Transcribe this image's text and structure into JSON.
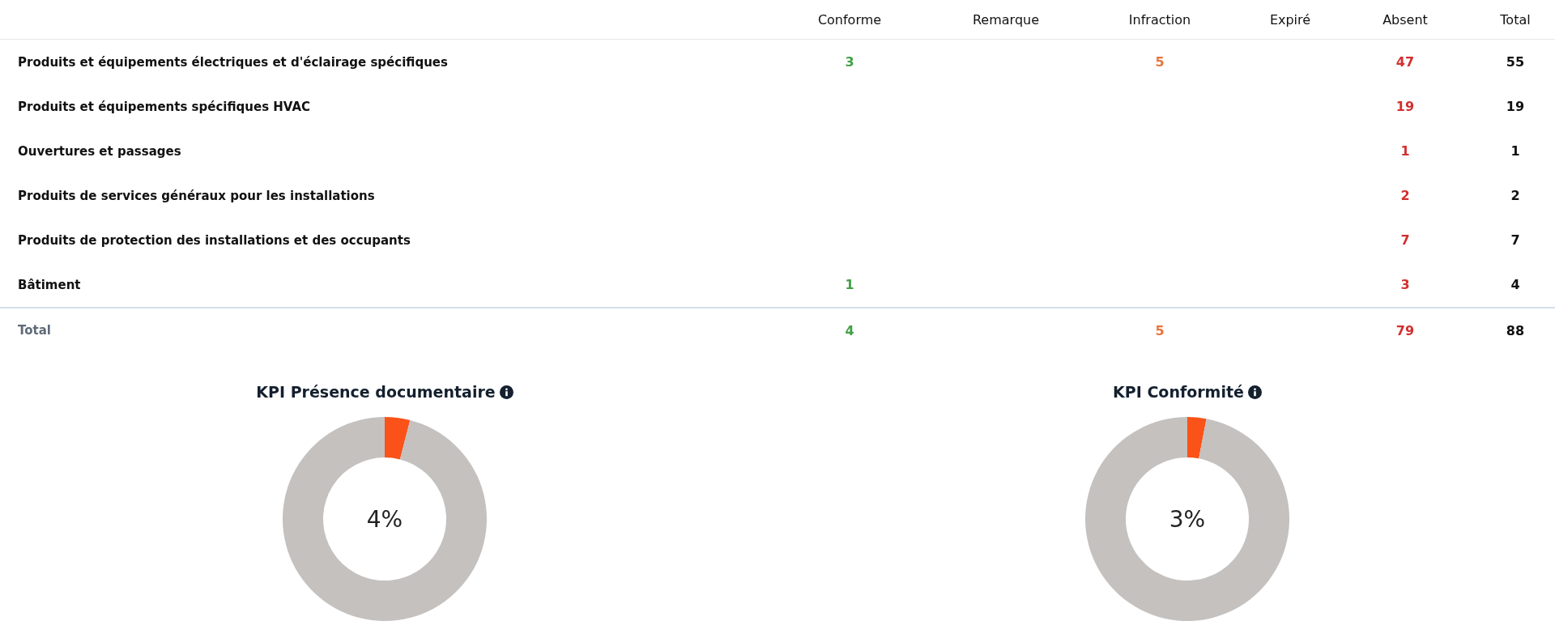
{
  "table": {
    "columns": [
      "Conforme",
      "Remarque",
      "Infraction",
      "Expiré",
      "Absent",
      "Total"
    ],
    "rows": [
      {
        "label": "Produits et équipements électriques et d'éclairage spécifiques",
        "cells": [
          {
            "value": "3",
            "color": "#43a047"
          },
          null,
          {
            "value": "5",
            "color": "#e8743b"
          },
          null,
          {
            "value": "47",
            "color": "#d32f2f"
          },
          {
            "value": "55",
            "color": "#111111"
          }
        ]
      },
      {
        "label": "Produits et équipements spécifiques HVAC",
        "cells": [
          null,
          null,
          null,
          null,
          {
            "value": "19",
            "color": "#d32f2f"
          },
          {
            "value": "19",
            "color": "#111111"
          }
        ]
      },
      {
        "label": "Ouvertures et passages",
        "cells": [
          null,
          null,
          null,
          null,
          {
            "value": "1",
            "color": "#d32f2f"
          },
          {
            "value": "1",
            "color": "#111111"
          }
        ]
      },
      {
        "label": "Produits de services généraux pour les installations",
        "cells": [
          null,
          null,
          null,
          null,
          {
            "value": "2",
            "color": "#d32f2f"
          },
          {
            "value": "2",
            "color": "#111111"
          }
        ]
      },
      {
        "label": "Produits de protection des installations et des occupants",
        "cells": [
          null,
          null,
          null,
          null,
          {
            "value": "7",
            "color": "#d32f2f"
          },
          {
            "value": "7",
            "color": "#111111"
          }
        ]
      },
      {
        "label": "Bâtiment",
        "cells": [
          {
            "value": "1",
            "color": "#43a047"
          },
          null,
          null,
          null,
          {
            "value": "3",
            "color": "#d32f2f"
          },
          {
            "value": "4",
            "color": "#111111"
          }
        ]
      }
    ],
    "total": {
      "label": "Total",
      "cells": [
        {
          "value": "4",
          "color": "#43a047"
        },
        null,
        {
          "value": "5",
          "color": "#e8743b"
        },
        null,
        {
          "value": "79",
          "color": "#d32f2f"
        },
        {
          "value": "88",
          "color": "#111111"
        }
      ]
    }
  },
  "kpis": [
    {
      "title": "KPI Présence documentaire",
      "center_label": "4%",
      "chart_data": {
        "type": "donut",
        "values": [
          4,
          96
        ]
      }
    },
    {
      "title": "KPI Conformité",
      "center_label": "3%",
      "chart_data": {
        "type": "donut",
        "values": [
          3,
          97
        ]
      }
    }
  ]
}
